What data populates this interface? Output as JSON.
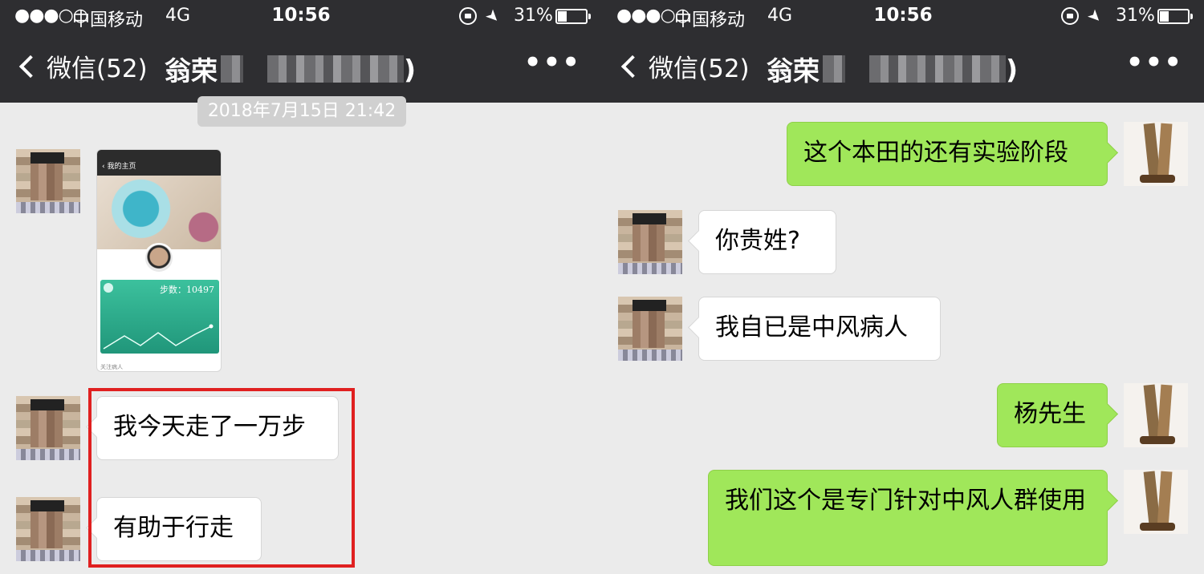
{
  "status_bar": {
    "signal": "●●●○○",
    "carrier": "中国移动",
    "network": "4G",
    "time": "10:56",
    "battery_percent": "31%"
  },
  "nav": {
    "back_label": "微信(52)",
    "title_prefix": "翁荣",
    "title_suffix": ")",
    "more_label": "•••"
  },
  "left_screen": {
    "timestamp": "2018年7月15日 21:42",
    "screenshot_card": {
      "header_title": "我的主页",
      "steps_label": "步数：10497",
      "footer_text": "关注病人"
    },
    "messages": [
      {
        "from": "contact",
        "text": "我今天走了一万步"
      },
      {
        "from": "contact",
        "text": "有助于行走"
      }
    ]
  },
  "right_screen": {
    "messages": [
      {
        "from": "self",
        "text": "这个本田的还有实验阶段"
      },
      {
        "from": "contact",
        "text": "你贵姓?"
      },
      {
        "from": "contact",
        "text": "我自已是中风病人"
      },
      {
        "from": "self",
        "text": "杨先生"
      },
      {
        "from": "self",
        "text": "我们这个是专门针对中风人群使用"
      }
    ]
  },
  "colors": {
    "navbar": "#2e2e31",
    "chat_bg": "#ebebeb",
    "self_bubble": "#a0e75a",
    "highlight_box": "#e02020"
  }
}
